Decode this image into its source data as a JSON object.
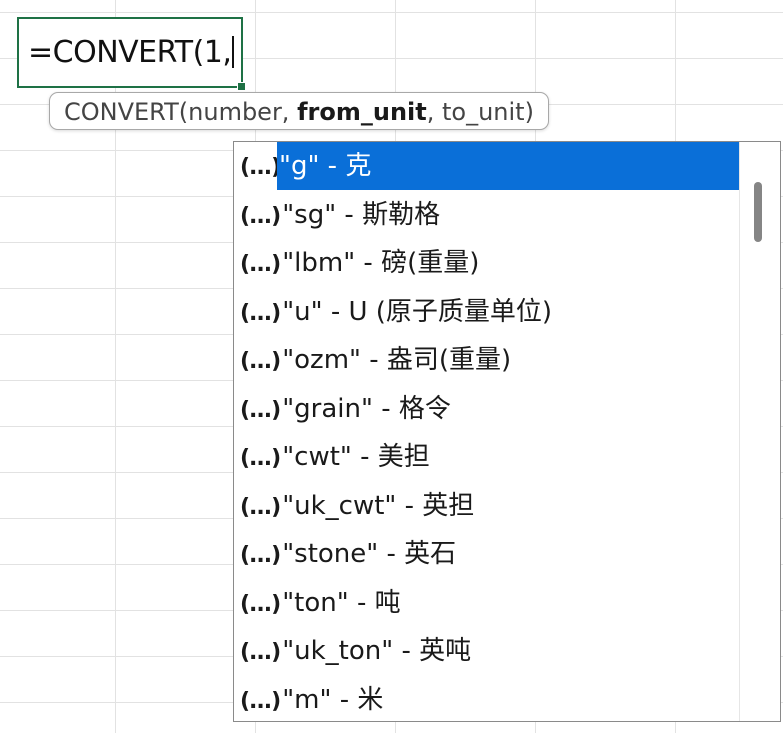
{
  "cell": {
    "formula": "=CONVERT(1,"
  },
  "tooltip": {
    "func": "CONVERT(",
    "arg1": "number, ",
    "arg2": "from_unit",
    "arg3": ", to_unit)"
  },
  "dropdown": {
    "icon": "(...)",
    "items": [
      {
        "label": "\"g\" - 克",
        "selected": true
      },
      {
        "label": "\"sg\" - 斯勒格"
      },
      {
        "label": "\"lbm\" - 磅(重量)"
      },
      {
        "label": "\"u\" - U (原子质量单位)"
      },
      {
        "label": "\"ozm\" - 盎司(重量)"
      },
      {
        "label": "\"grain\" - 格令"
      },
      {
        "label": "\"cwt\" - 美担"
      },
      {
        "label": "\"uk_cwt\" - 英担"
      },
      {
        "label": "\"stone\" - 英石"
      },
      {
        "label": "\"ton\" - 吨"
      },
      {
        "label": "\"uk_ton\" - 英吨"
      },
      {
        "label": "\"m\" - 米"
      }
    ]
  },
  "colors": {
    "selection": "#0a6fd8",
    "cell_border": "#1e7145"
  }
}
